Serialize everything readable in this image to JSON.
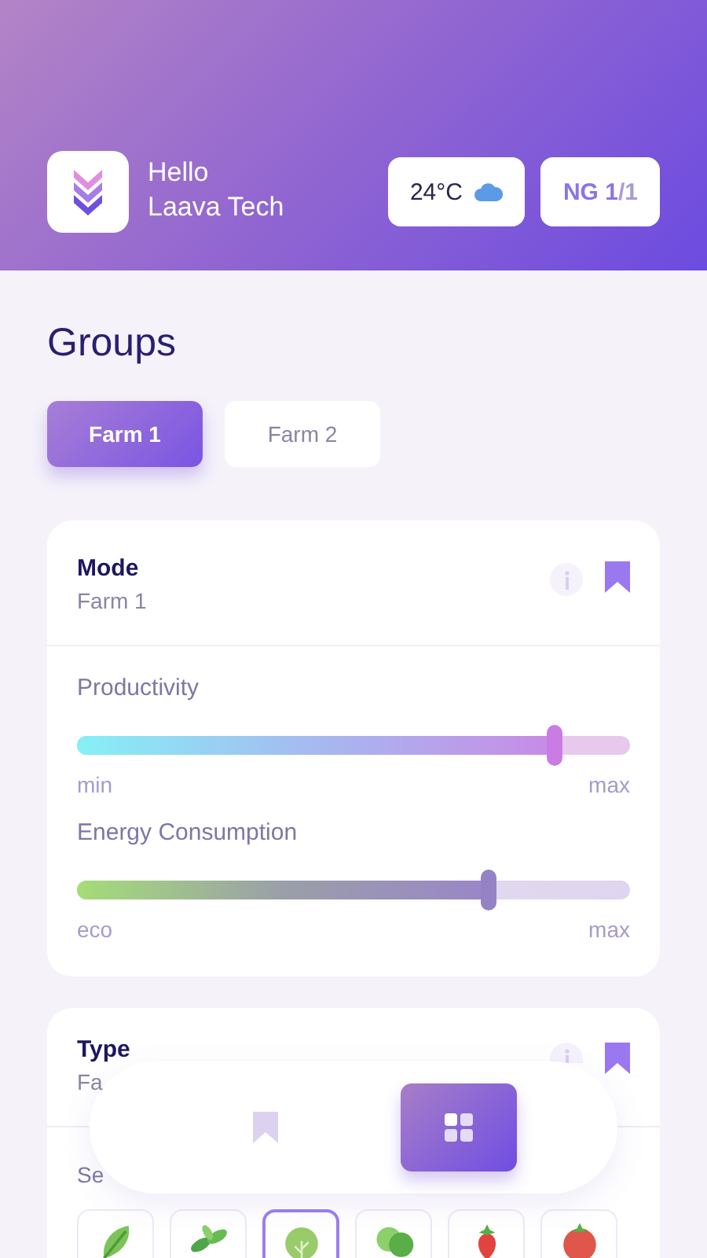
{
  "header": {
    "greeting": "Hello",
    "name": "Laava Tech",
    "weather": "24°C",
    "ng_label": "NG",
    "ng_current": "1",
    "ng_total": "/1"
  },
  "title": "Groups",
  "tabs": [
    {
      "label": "Farm 1",
      "selected": true
    },
    {
      "label": "Farm 2",
      "selected": false
    }
  ],
  "mode_card": {
    "title": "Mode",
    "subtitle": "Farm 1",
    "bookmarked": true,
    "sliders": [
      {
        "label": "Productivity",
        "level": 0.865,
        "kind": "productivity",
        "min": "min",
        "max": "max"
      },
      {
        "label": "Energy Consumption",
        "level": 0.745,
        "kind": "energy",
        "min": "eco",
        "max": "max"
      }
    ]
  },
  "type_card": {
    "title": "Type",
    "subtitle": "Fa",
    "bookmarked": true,
    "section": "Se",
    "crops": [
      {
        "kind": "leaf",
        "selected": false
      },
      {
        "kind": "herb",
        "selected": false
      },
      {
        "kind": "cabbage",
        "selected": true
      },
      {
        "kind": "lettuce",
        "selected": false
      },
      {
        "kind": "strawberry",
        "selected": false
      },
      {
        "kind": "tomato",
        "selected": false
      }
    ]
  },
  "bottom_nav": [
    {
      "kind": "bookmark",
      "selected": false
    },
    {
      "kind": "grid",
      "selected": true
    }
  ]
}
